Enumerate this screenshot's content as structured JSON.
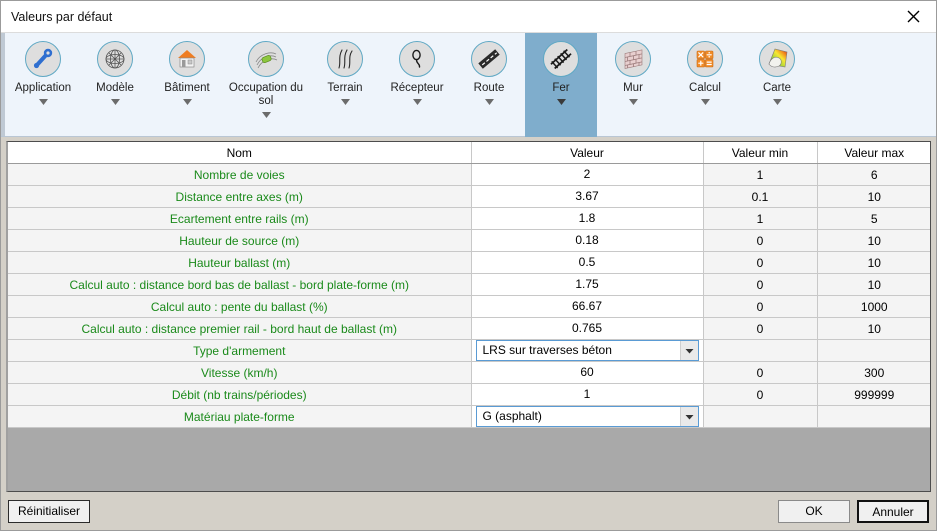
{
  "window": {
    "title": "Valeurs par défaut",
    "close_icon": "close-icon"
  },
  "ribbon": {
    "items": [
      {
        "label": "Application",
        "icon": "wrench-icon",
        "selected": false,
        "has_caret": true
      },
      {
        "label": "Modèle",
        "icon": "mesh-sphere-icon",
        "selected": false,
        "has_caret": true
      },
      {
        "label": "Bâtiment",
        "icon": "building-icon",
        "selected": false,
        "has_caret": true
      },
      {
        "label": "Occupation du sol",
        "icon": "land-use-icon",
        "selected": false,
        "has_caret": true
      },
      {
        "label": "Terrain",
        "icon": "terrain-contour-icon",
        "selected": false,
        "has_caret": true
      },
      {
        "label": "Récepteur",
        "icon": "receiver-icon",
        "selected": false,
        "has_caret": true
      },
      {
        "label": "Route",
        "icon": "road-icon",
        "selected": false,
        "has_caret": true
      },
      {
        "label": "Fer",
        "icon": "railway-icon",
        "selected": true,
        "has_caret": true
      },
      {
        "label": "Mur",
        "icon": "wall-brick-icon",
        "selected": false,
        "has_caret": true
      },
      {
        "label": "Calcul",
        "icon": "calculator-icon",
        "selected": false,
        "has_caret": true
      },
      {
        "label": "Carte",
        "icon": "color-map-icon",
        "selected": false,
        "has_caret": true
      }
    ]
  },
  "table": {
    "headers": [
      "Nom",
      "Valeur",
      "Valeur min",
      "Valeur max"
    ],
    "rows": [
      {
        "name": "Nombre de voies",
        "value": "2",
        "type": "text",
        "min": "1",
        "max": "6"
      },
      {
        "name": "Distance entre axes (m)",
        "value": "3.67",
        "type": "text",
        "min": "0.1",
        "max": "10"
      },
      {
        "name": "Ecartement entre rails (m)",
        "value": "1.8",
        "type": "text",
        "min": "1",
        "max": "5"
      },
      {
        "name": "Hauteur de source (m)",
        "value": "0.18",
        "type": "text",
        "min": "0",
        "max": "10"
      },
      {
        "name": "Hauteur ballast (m)",
        "value": "0.5",
        "type": "text",
        "min": "0",
        "max": "10"
      },
      {
        "name": "Calcul auto : distance bord bas de ballast - bord plate-forme (m)",
        "value": "1.75",
        "type": "text",
        "min": "0",
        "max": "10"
      },
      {
        "name": "Calcul auto : pente du ballast (%)",
        "value": "66.67",
        "type": "text",
        "min": "0",
        "max": "1000"
      },
      {
        "name": "Calcul auto : distance premier rail - bord haut de ballast (m)",
        "value": "0.765",
        "type": "text",
        "min": "0",
        "max": "10"
      },
      {
        "name": "Type d'armement",
        "value": "LRS sur traverses béton",
        "type": "select",
        "min": "",
        "max": ""
      },
      {
        "name": "Vitesse (km/h)",
        "value": "60",
        "type": "text",
        "min": "0",
        "max": "300"
      },
      {
        "name": "Débit (nb trains/périodes)",
        "value": "1",
        "type": "text",
        "min": "0",
        "max": "999999"
      },
      {
        "name": "Matériau plate-forme",
        "value": "G (asphalt)",
        "type": "select",
        "min": "",
        "max": ""
      }
    ]
  },
  "footer": {
    "reset_label": "Réinitialiser",
    "ok_label": "OK",
    "cancel_label": "Annuler"
  },
  "colors": {
    "selected_tab": "#7fadcc",
    "ribbon_bg": "#eef4fb",
    "param_name_green": "#1a8a1a",
    "dialog_bg": "#d4d0c8"
  }
}
